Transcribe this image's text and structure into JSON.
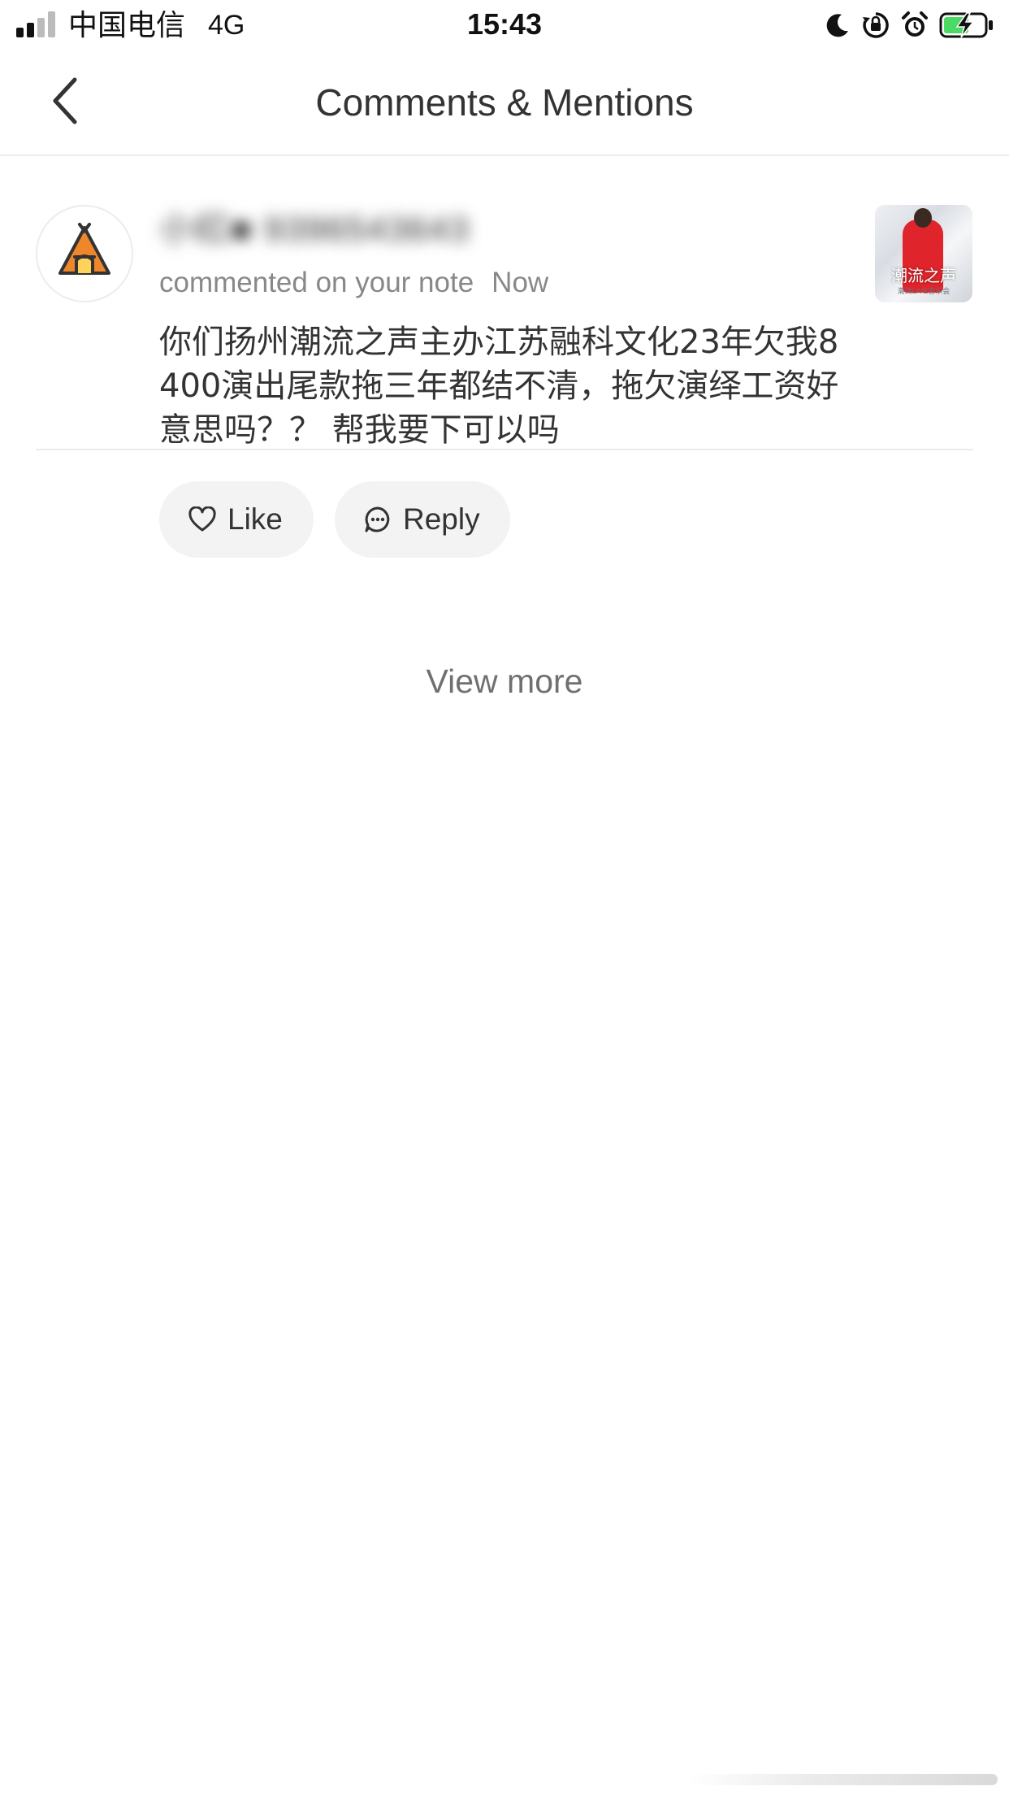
{
  "status_bar": {
    "carrier": "中国电信",
    "network": "4G",
    "time": "15:43",
    "signal_bars_active": 2,
    "battery_level": 0.6,
    "battery_charging": true,
    "icons": [
      "moon-icon",
      "orientation-lock-icon",
      "alarm-icon",
      "battery-icon"
    ],
    "battery_color": "#4cd964"
  },
  "nav": {
    "back_icon": "chevron-left-icon",
    "title": "Comments & Mentions"
  },
  "notification": {
    "username": "小红■ 9396543643",
    "action": "commented on your note",
    "time": "Now",
    "comment": "你们扬州潮流之声主办江苏融科文化23年欠我8400演出尾款拖三年都结不清，拖欠演绎工资好意思吗？？ 帮我要下可以吗",
    "avatar_icon": "tent-icon",
    "thumbnail": {
      "title": "潮流之声",
      "subtitle": "潮流LIVE音乐会"
    },
    "actions": {
      "like_label": "Like",
      "reply_label": "Reply"
    }
  },
  "view_more": "View more",
  "colors": {
    "text": "#333333",
    "secondary_text": "#888888",
    "pill_bg": "#f3f3f3",
    "avatar_tent_orange": "#f0862a"
  }
}
